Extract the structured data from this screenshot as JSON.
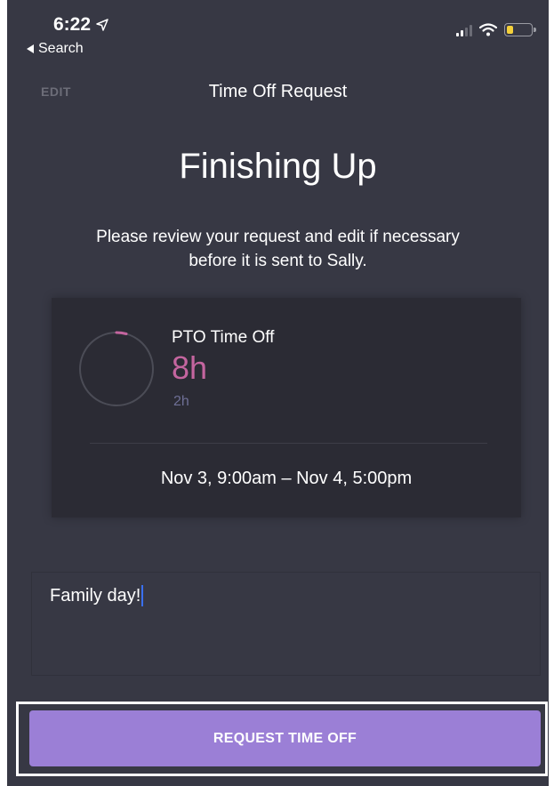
{
  "status_bar": {
    "time": "6:22",
    "location_icon": "location-arrow-icon",
    "back_label": "Search",
    "battery_color": "#f4d03a"
  },
  "nav": {
    "edit_label": "EDIT",
    "title": "Time Off Request"
  },
  "header": {
    "title": "Finishing Up",
    "subtitle": "Please review your request and edit if necessary before it is sent to Sally."
  },
  "summary": {
    "leave_type": "PTO Time Off",
    "hours_requested": "8h",
    "hours_secondary": "2h",
    "date_range": "Nov 3, 9:00am – Nov 4, 5:00pm",
    "accent_color": "#c4659f"
  },
  "note": {
    "text": "Family day!"
  },
  "actions": {
    "request_label": "REQUEST TIME OFF",
    "button_color": "#9b7fd6"
  }
}
